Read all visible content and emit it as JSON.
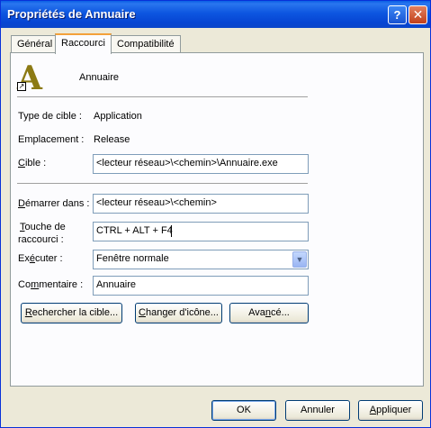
{
  "window": {
    "title": "Propriétés de Annuaire",
    "help_label": "?",
    "close_label": "✕"
  },
  "tabs": [
    {
      "label": "Général",
      "active": false
    },
    {
      "label": "Raccourci",
      "active": true
    },
    {
      "label": "Compatibilité",
      "active": false
    }
  ],
  "shortcut": {
    "icon_name": "annuaire-app-icon",
    "icon_glyph": "A",
    "name": "Annuaire",
    "target_type_label": "Type de cible :",
    "target_type_value": "Application",
    "location_label": "Emplacement :",
    "location_value": "Release",
    "target_label_accel": "C",
    "target_label_rest": "ible :",
    "target_value": "<lecteur réseau>\\<chemin>\\Annuaire.exe",
    "start_in_label_accel": "D",
    "start_in_label_rest": "émarrer dans :",
    "start_in_value": "<lecteur réseau>\\<chemin>",
    "hotkey_label_accel": "T",
    "hotkey_label_rest": "ouche de",
    "hotkey_label_line2": "raccourci :",
    "hotkey_value": "CTRL + ALT + F4",
    "run_label_pre": "Ex",
    "run_label_accel": "é",
    "run_label_rest": "cuter :",
    "run_value": "Fenêtre normale",
    "comment_label_accel": "m",
    "comment_label_pre": "Co",
    "comment_label_rest": "mentaire :",
    "comment_value": "Annuaire"
  },
  "actions": {
    "find_target_accel": "R",
    "find_target_rest": "echercher la cible...",
    "change_icon_accel": "C",
    "change_icon_rest": "hanger d'icône...",
    "advanced_pre": "Ava",
    "advanced_accel": "n",
    "advanced_rest": "cé..."
  },
  "footer": {
    "ok": "OK",
    "cancel": "Annuler",
    "apply_accel": "A",
    "apply_rest": "ppliquer"
  }
}
